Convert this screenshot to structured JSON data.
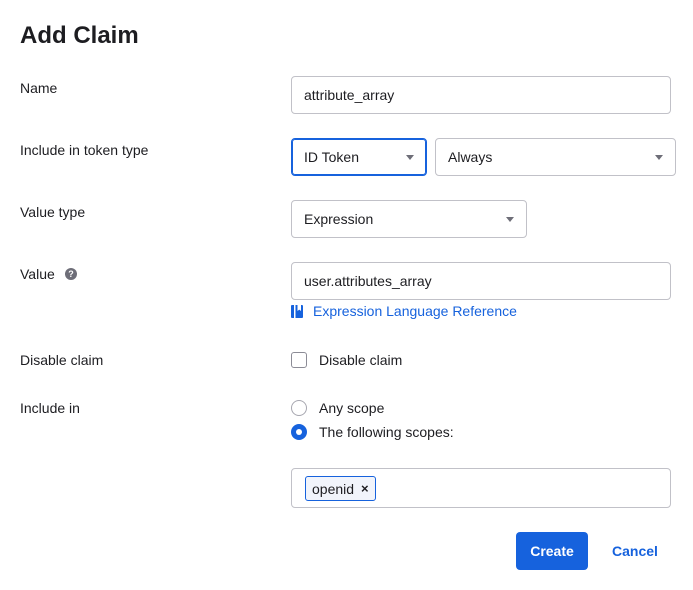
{
  "dialog": {
    "title": "Add Claim"
  },
  "name_field": {
    "label": "Name",
    "value": "attribute_array"
  },
  "token_type": {
    "label": "Include in token type",
    "type_value": "ID Token",
    "frequency_value": "Always"
  },
  "value_type": {
    "label": "Value type",
    "selected": "Expression"
  },
  "value_field": {
    "label": "Value",
    "help_icon": "?",
    "value": "user.attributes_array",
    "link_text": "Expression Language Reference"
  },
  "disable_claim": {
    "label": "Disable claim",
    "checkbox_label": "Disable claim",
    "checked": false
  },
  "include_in": {
    "label": "Include in",
    "option_any": "Any scope",
    "option_following": "The following scopes:",
    "selected": "The following scopes:",
    "scopes": [
      "openid"
    ],
    "chip_remove": "×"
  },
  "actions": {
    "create_label": "Create",
    "cancel_label": "Cancel"
  },
  "colors": {
    "accent": "#1662dd",
    "text": "#1d1d21",
    "border": "#c1c1c8"
  }
}
